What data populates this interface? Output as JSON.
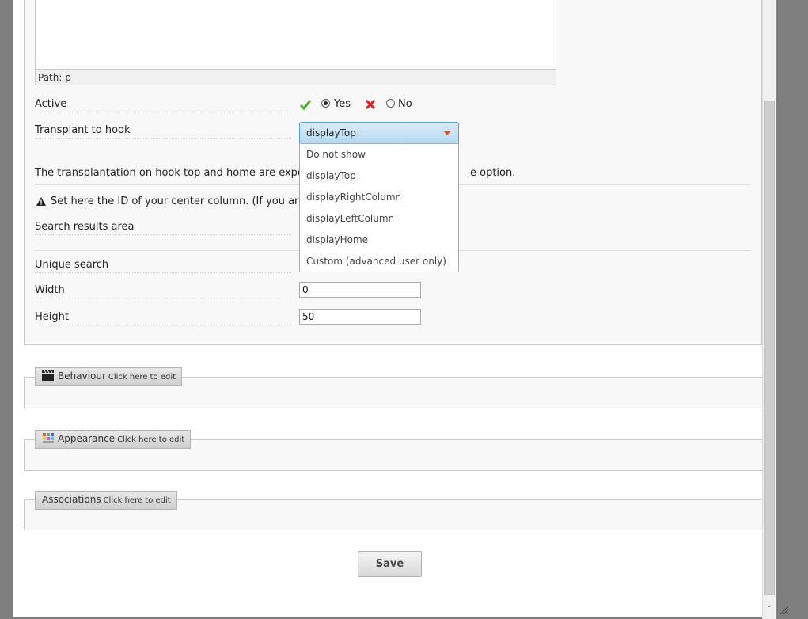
{
  "editor": {
    "path_label": "Path: p"
  },
  "form": {
    "active": {
      "label": "Active",
      "yes_label": "Yes",
      "no_label": "No",
      "selected": "Yes"
    },
    "hook": {
      "label": "Transplant to hook",
      "selected": "displayTop",
      "options": [
        "Do not show",
        "displayTop",
        "displayRightColumn",
        "displayLeftColumn",
        "displayHome",
        "Custom (advanced user only)"
      ]
    },
    "info_text_left": "The transplantation on hook top and home are experiment",
    "info_text_right": "e option.",
    "center_column_note": "Set here the ID of your center column. (If you are not s",
    "search_results_area_label": "Search results area",
    "unique_search_label": "Unique search",
    "width": {
      "label": "Width",
      "value": "0"
    },
    "height": {
      "label": "Height",
      "value": "50"
    }
  },
  "sections": [
    {
      "title": "Behaviour",
      "hint": "Click here to edit",
      "icon": "clapperboard-icon"
    },
    {
      "title": "Appearance",
      "hint": "Click here to edit",
      "icon": "color-palette-icon"
    },
    {
      "title": "Associations",
      "hint": "Click here to edit"
    }
  ],
  "save_button": {
    "label": "Save"
  },
  "colors": {
    "accent_border": "#5a9ecf",
    "caret": "#e04a1e",
    "check": "#4caf2a",
    "x_mark": "#e02020"
  }
}
